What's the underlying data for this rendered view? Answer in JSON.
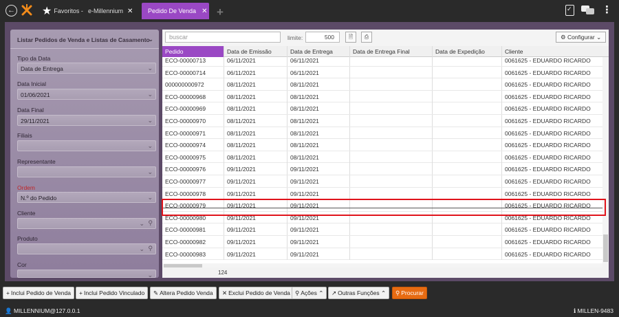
{
  "topbar": {
    "tabs": [
      {
        "label": "Favoritos -"
      },
      {
        "label": "e-Millennium"
      },
      {
        "label": "Pedido De Venda"
      }
    ]
  },
  "filters": {
    "panel_title": "Listar Pedidos de Venda e Listas de Casamento",
    "tipo_label": "Tipo da Data",
    "tipo_value": "Data de Entrega",
    "data_inicial_label": "Data Inicial",
    "data_inicial_value": "01/06/2021",
    "data_final_label": "Data Final",
    "data_final_value": "29/11/2021",
    "filiais_label": "Filiais",
    "representante_label": "Representante",
    "ordem_label": "Ordem",
    "ordem_value": "N.º do Pedido",
    "cliente_label": "Cliente",
    "produto_label": "Produto",
    "cor_label": "Cor"
  },
  "toolbar": {
    "search_placeholder": "buscar",
    "limit_label": "limite:",
    "limit_value": "500",
    "config_label": "Configurar"
  },
  "grid": {
    "columns": [
      "Pedido",
      "Data de Emissão",
      "Data de Entrega",
      "Data de Entrega Final",
      "Data de Expedição",
      "Cliente"
    ],
    "rows": [
      [
        "ECO-00000713",
        "06/11/2021",
        "06/11/2021",
        "",
        "",
        "0061625 - EDUARDO RICARDO"
      ],
      [
        "ECO-00000714",
        "06/11/2021",
        "06/11/2021",
        "",
        "",
        "0061625 - EDUARDO RICARDO"
      ],
      [
        "000000000972",
        "08/11/2021",
        "08/11/2021",
        "",
        "",
        "0061625 - EDUARDO RICARDO"
      ],
      [
        "ECO-00000968",
        "08/11/2021",
        "08/11/2021",
        "",
        "",
        "0061625 - EDUARDO RICARDO"
      ],
      [
        "ECO-00000969",
        "08/11/2021",
        "08/11/2021",
        "",
        "",
        "0061625 - EDUARDO RICARDO"
      ],
      [
        "ECO-00000970",
        "08/11/2021",
        "08/11/2021",
        "",
        "",
        "0061625 - EDUARDO RICARDO"
      ],
      [
        "ECO-00000971",
        "08/11/2021",
        "08/11/2021",
        "",
        "",
        "0061625 - EDUARDO RICARDO"
      ],
      [
        "ECO-00000974",
        "08/11/2021",
        "08/11/2021",
        "",
        "",
        "0061625 - EDUARDO RICARDO"
      ],
      [
        "ECO-00000975",
        "08/11/2021",
        "08/11/2021",
        "",
        "",
        "0061625 - EDUARDO RICARDO"
      ],
      [
        "ECO-00000976",
        "09/11/2021",
        "09/11/2021",
        "",
        "",
        "0061625 - EDUARDO RICARDO"
      ],
      [
        "ECO-00000977",
        "09/11/2021",
        "09/11/2021",
        "",
        "",
        "0061625 - EDUARDO RICARDO"
      ],
      [
        "ECO-00000978",
        "09/11/2021",
        "09/11/2021",
        "",
        "",
        "0061625 - EDUARDO RICARDO"
      ],
      [
        "ECO-00000979",
        "09/11/2021",
        "09/11/2021",
        "",
        "",
        "0061625 - EDUARDO RICARDO"
      ],
      [
        "ECO-00000980",
        "09/11/2021",
        "09/11/2021",
        "",
        "",
        "0061625 - EDUARDO RICARDO"
      ],
      [
        "ECO-00000981",
        "09/11/2021",
        "09/11/2021",
        "",
        "",
        "0061625 - EDUARDO RICARDO"
      ],
      [
        "ECO-00000982",
        "09/11/2021",
        "09/11/2021",
        "",
        "",
        "0061625 - EDUARDO RICARDO"
      ],
      [
        "ECO-00000983",
        "09/11/2021",
        "09/11/2021",
        "",
        "",
        "0061625 - EDUARDO RICARDO"
      ]
    ],
    "count": "124"
  },
  "actions": {
    "inclui_pedido": "Inclui Pedido de Venda",
    "inclui_vinculado": "Inclui Pedido Vinculado",
    "altera": "Altera Pedido Venda",
    "exclui": "Exclui Pedido de Venda",
    "acoes": "Ações",
    "outras": "Outras Funções",
    "procurar": "Procurar"
  },
  "status": {
    "user": "MILLENNIUM@127.0.0.1",
    "server": "MILLEN-9483"
  },
  "colors": {
    "accent": "#9a48c4",
    "primary_button": "#e76b12",
    "highlight": "#e0131b"
  }
}
